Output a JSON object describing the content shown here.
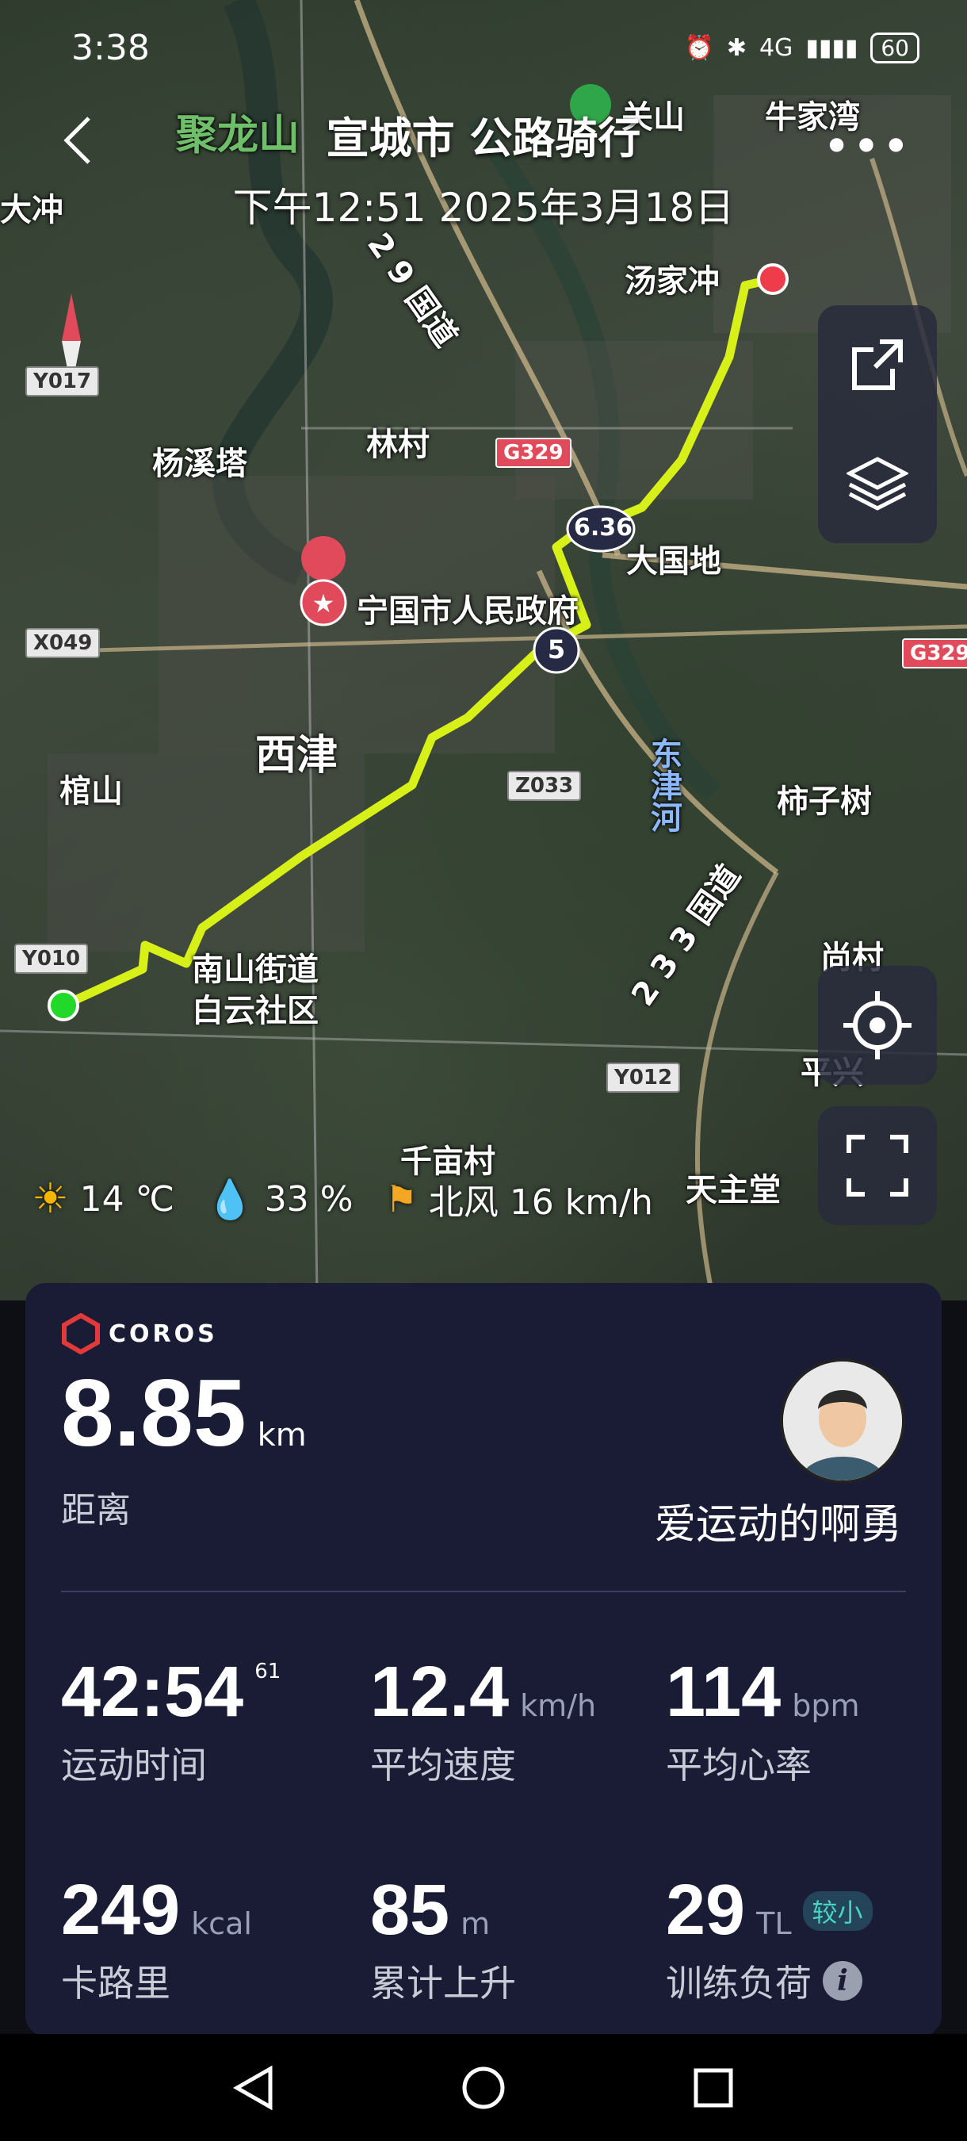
{
  "status_bar": {
    "time": "3:38",
    "network": "4G",
    "battery": "60"
  },
  "header": {
    "title": "宣城市 公路骑行",
    "subtitle": "下午12:51 2025年3月18日"
  },
  "map": {
    "labels": {
      "julongshan": "聚龙山",
      "guanshan": "关山",
      "niujiawan": "牛家湾",
      "dachong": "大冲",
      "tangjiachong": "汤家冲",
      "yangxita": "杨溪塔",
      "lincun": "林村",
      "daguodi": "大国地",
      "ningguo_gov": "宁国市人民政府",
      "xijin": "西津",
      "guanshan2": "棺山",
      "shizishu": "柿子树",
      "dongjinhe": "东津河",
      "nanshan": "南山街道",
      "baiyun": "白云社区",
      "shangcun": "尚村",
      "pingxing": "平兴",
      "qianmucun": "千亩村",
      "tianzhutang": "天主堂",
      "road329": "2 9 国道",
      "road233": "2 3 3 国道"
    },
    "road_tags": {
      "y017": "Y017",
      "x049": "X049",
      "g329a": "G329",
      "g329b": "G329",
      "z033": "Z033",
      "y010": "Y010",
      "y012": "Y012"
    },
    "km_markers": {
      "m1": "6.36",
      "m2": "5"
    },
    "route_color": "#d6f018"
  },
  "weather": {
    "temp": "14 ℃",
    "humidity": "33 %",
    "wind": "北风 16 km/h"
  },
  "card": {
    "brand": "COROS",
    "distance": {
      "value": "8.85",
      "unit": "km",
      "label": "距离"
    },
    "username": "爱运动的啊勇",
    "stats": [
      {
        "value": "42:54",
        "sup": "61",
        "unit": "",
        "label": "运动时间"
      },
      {
        "value": "12.4",
        "unit": "km/h",
        "label": "平均速度"
      },
      {
        "value": "114",
        "unit": "bpm",
        "label": "平均心率"
      },
      {
        "value": "249",
        "unit": "kcal",
        "label": "卡路里"
      },
      {
        "value": "85",
        "unit": "m",
        "label": "累计上升"
      },
      {
        "value": "29",
        "unit": "TL",
        "label": "训练负荷",
        "tag": "较小"
      }
    ]
  }
}
